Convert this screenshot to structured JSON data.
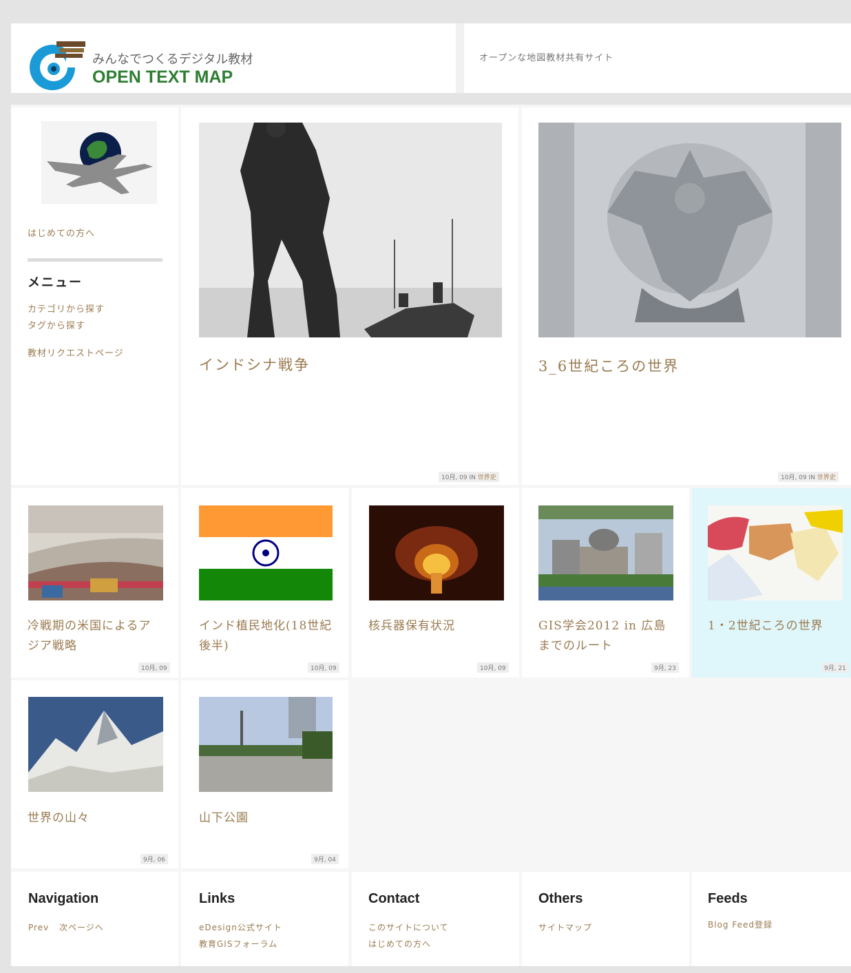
{
  "header": {
    "logo_sub": "みんなでつくるデジタル教材",
    "logo_main": "OPEN TEXT MAP",
    "tagline": "オープンな地図教材共有サイト"
  },
  "sidebar": {
    "welcome_link": "はじめての方へ",
    "menu_title": "メニュー",
    "menu_items": [
      "カテゴリから探す",
      "タグから探す",
      "教材リクエストページ"
    ]
  },
  "posts": [
    {
      "title": "インドシナ戦争",
      "date": "10月, 09",
      "in": "IN",
      "category": "世界史",
      "image": "soldier-photo"
    },
    {
      "title": "3_6世紀ころの世界",
      "date": "10月, 09",
      "in": "IN",
      "category": "世界史",
      "image": "eagle-relief-photo"
    },
    {
      "title": "冷戦期の米国によるアジア戦略",
      "date": "10月, 09",
      "image": "berlin-wall-photo"
    },
    {
      "title": "インド植民地化(18世紀後半)",
      "date": "10月, 09",
      "image": "india-flag"
    },
    {
      "title": "核兵器保有状況",
      "date": "10月, 09",
      "image": "nuclear-explosion-photo"
    },
    {
      "title": "GIS学会2012 in 広島までのルート",
      "date": "9月, 23",
      "image": "hiroshima-dome-photo"
    },
    {
      "title": "1・2世紀ころの世界",
      "date": "9月, 21",
      "image": "ancient-world-map"
    },
    {
      "title": "世界の山々",
      "date": "9月, 06",
      "image": "mountain-photo"
    },
    {
      "title": "山下公園",
      "date": "9月, 04",
      "image": "yamashita-park-photo"
    }
  ],
  "footer": {
    "navigation": {
      "title": "Navigation",
      "prev": "Prev",
      "next": "次ページへ"
    },
    "links": {
      "title": "Links",
      "items": [
        "eDesign公式サイト",
        "教育GISフォーラム"
      ]
    },
    "contact": {
      "title": "Contact",
      "items": [
        "このサイトについて",
        "はじめての方へ"
      ]
    },
    "others": {
      "title": "Others",
      "items": [
        "サイトマップ"
      ]
    },
    "feeds": {
      "title": "Feeds",
      "items": [
        "Blog Feed登録"
      ]
    }
  },
  "colors": {
    "accent": "#9a7b50",
    "logo_green": "#2e7d32",
    "logo_blue": "#1a9ad6",
    "highlight": "#dff6fb"
  }
}
